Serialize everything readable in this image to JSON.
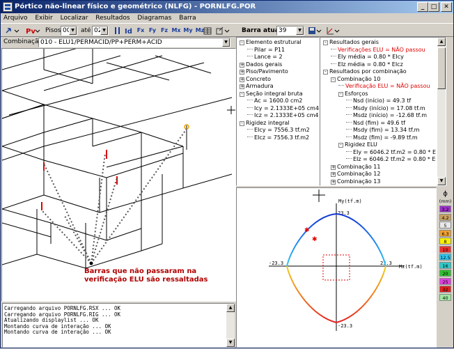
{
  "window": {
    "title": "Pórtico não-linear físico e geométrico (NLFG) - PORNLFG.POR",
    "buttons": {
      "minimize": "_",
      "maximize": "□",
      "close": "✕"
    }
  },
  "menu": [
    "Arquivo",
    "Exibir",
    "Localizar",
    "Resultados",
    "Diagramas",
    "Barra"
  ],
  "toolbar": {
    "pisos_label": "Pisos:",
    "pisos_from": "00",
    "ate_label": "até",
    "pisos_to": "02",
    "barra_label": "Barra atual:",
    "barra_value": "39",
    "icons": [
      "Fx",
      "Fy",
      "Fz",
      "Mx",
      "My",
      "Mz"
    ]
  },
  "combination": {
    "label": "Combinação:",
    "value": "010 - ELU1/PERMACID/PP+PERM+ACID"
  },
  "caption": {
    "line1": "Barras que não passaram na",
    "line2": "verificação ELU são ressaltadas"
  },
  "tree_left": [
    {
      "t": "Elemento estrutural",
      "lvl": 0,
      "pm": "-"
    },
    {
      "t": "Pilar = P11",
      "lvl": 1
    },
    {
      "t": "Lance = 2",
      "lvl": 1
    },
    {
      "t": "Dados gerais",
      "lvl": 0,
      "pm": "+"
    },
    {
      "t": "Piso/Pavimento",
      "lvl": 0,
      "pm": "+"
    },
    {
      "t": "Concreto",
      "lvl": 0,
      "pm": "+"
    },
    {
      "t": "Armadura",
      "lvl": 0,
      "pm": "+"
    },
    {
      "t": "Seção integral bruta",
      "lvl": 0,
      "pm": "-"
    },
    {
      "t": "Ac = 1600.0 cm2",
      "lvl": 1
    },
    {
      "t": "Icy = 2.1333E+05 cm4",
      "lvl": 1
    },
    {
      "t": "Icz = 2.1333E+05 cm4",
      "lvl": 1
    },
    {
      "t": "Rigidez integral",
      "lvl": 0,
      "pm": "-"
    },
    {
      "t": "EIcy = 7556.3 tf.m2",
      "lvl": 1
    },
    {
      "t": "EIcz = 7556.3 tf.m2",
      "lvl": 1
    }
  ],
  "tree_right": [
    {
      "t": "Resultados gerais",
      "lvl": 0,
      "pm": "-"
    },
    {
      "t": "Verificações ELU = NÃO passou",
      "lvl": 1,
      "red": true
    },
    {
      "t": "EIy média = 0.80 * EIcy",
      "lvl": 1
    },
    {
      "t": "EIz média = 0.80 * EIcz",
      "lvl": 1
    },
    {
      "t": "Resultados por combinação",
      "lvl": 0,
      "pm": "-"
    },
    {
      "t": "Combinação 10",
      "lvl": 1,
      "pm": "-"
    },
    {
      "t": "Verificação ELU = NÃO passou",
      "lvl": 2,
      "red": true
    },
    {
      "t": "Esforços",
      "lvl": 2,
      "pm": "-"
    },
    {
      "t": "Nsd (início) = 49.3 tf",
      "lvl": 3
    },
    {
      "t": "Msdy (início) = 17.08 tf.m",
      "lvl": 3
    },
    {
      "t": "Msdz (início) = -12.68 tf.m",
      "lvl": 3
    },
    {
      "t": "Nsd (fim) = 49.6 tf",
      "lvl": 3
    },
    {
      "t": "Msdy (fim) = 13.34 tf.m",
      "lvl": 3
    },
    {
      "t": "Msdz (fim) = -9.89 tf.m",
      "lvl": 3
    },
    {
      "t": "Rigidez ELU",
      "lvl": 2,
      "pm": "-"
    },
    {
      "t": "EIy = 6046.2 tf.m2 = 0.80 * EIcy",
      "lvl": 3
    },
    {
      "t": "EIz = 6046.2 tf.m2 = 0.80 * EIcz",
      "lvl": 3
    },
    {
      "t": "Combinação 11",
      "lvl": 1,
      "pm": "+"
    },
    {
      "t": "Combinação 12",
      "lvl": 1,
      "pm": "+"
    },
    {
      "t": "Combinação 13",
      "lvl": 1,
      "pm": "+"
    }
  ],
  "log_lines": [
    "Carregando arquivo PORNLFG.RSX ... OK",
    "Carregando arquivo PORNLFG.RIG ... OK",
    "Atualizando displaylist ... OK",
    "Montando curva de interação ... OK",
    "Montando curva de interação ... OK"
  ],
  "interaction": {
    "y_axis_label": "My(tf.m)",
    "z_axis_label": "Mz(tf.m)",
    "top": "23.3",
    "bottom": "-23.3",
    "left": "-23.3",
    "right": "23.3"
  },
  "legend": {
    "header": "ϕ",
    "unit": "(mm)",
    "items": [
      {
        "v": "3.2",
        "c": "#9b30c8"
      },
      {
        "v": "4.2",
        "c": "#c8a060"
      },
      {
        "v": "5",
        "c": "#e8e8e8"
      },
      {
        "v": "6.3",
        "c": "#f0a030"
      },
      {
        "v": "8",
        "c": "#f8f000"
      },
      {
        "v": "10",
        "c": "#f03030"
      },
      {
        "v": "12.5",
        "c": "#30c8f0"
      },
      {
        "v": "16",
        "c": "#30c8c8"
      },
      {
        "v": "20",
        "c": "#30c030"
      },
      {
        "v": "25",
        "c": "#e040e0"
      },
      {
        "v": "32",
        "c": "#e02020"
      },
      {
        "v": "40",
        "c": "#a0e8a0"
      }
    ]
  }
}
